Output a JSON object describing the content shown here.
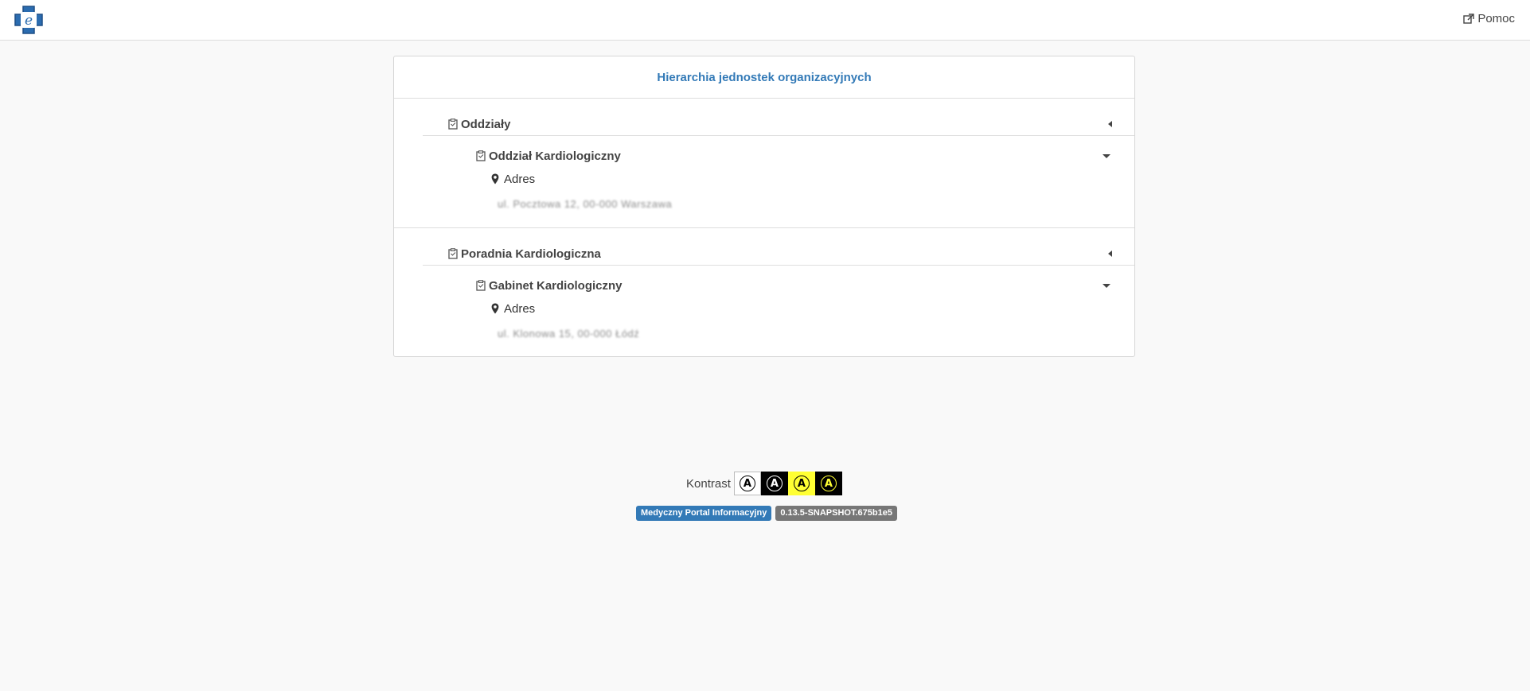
{
  "header": {
    "logo_letter": "e",
    "help_label": "Pomoc"
  },
  "panel": {
    "title": "Hierarchia jednostek organizacyjnych",
    "groups": [
      {
        "label": "Oddziały",
        "child": {
          "label": "Oddział Kardiologiczny",
          "address_label": "Adres",
          "address_value": "ul. Pocztowa 12, 00-000 Warszawa"
        }
      },
      {
        "label": "Poradnia Kardiologiczna",
        "child": {
          "label": "Gabinet Kardiologiczny",
          "address_label": "Adres",
          "address_value": "ul. Klonowa 15, 00-000 Łódź"
        }
      }
    ]
  },
  "footer": {
    "contrast_label": "Kontrast",
    "contrast_options": [
      "A",
      "A",
      "A",
      "A"
    ],
    "badge_app": "Medyczny Portal Informacyjny",
    "badge_version": "0.13.5-SNAPSHOT.675b1e5"
  },
  "colors": {
    "accent": "#337ab7",
    "badge_gray": "#777777",
    "contrast_yellow": "#ffff33"
  }
}
